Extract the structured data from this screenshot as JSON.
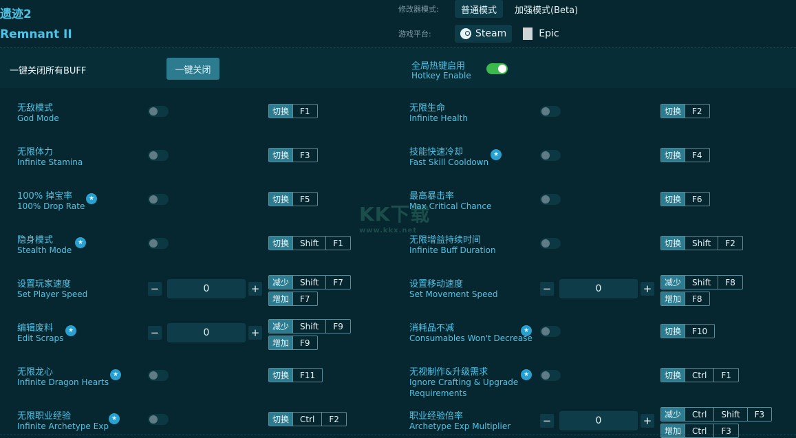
{
  "header": {
    "title_cn": "遗迹2",
    "title_en": "Remnant II",
    "mode_label": "修改器模式:",
    "mode_normal": "普通模式",
    "mode_beta": "加强模式(Beta)",
    "platform_label": "游戏平台:",
    "platform_steam": "Steam",
    "platform_epic": "Epic",
    "epic_logo_text": "EPIC GAMES"
  },
  "top": {
    "close_all_label": "一键关闭所有BUFF",
    "close_all_button": "一键关闭",
    "hotkey_cn": "全局热键启用",
    "hotkey_en": "Hotkey Enable",
    "hotkey_enabled": true
  },
  "actions": {
    "toggle": "切换",
    "decrease": "减少",
    "increase": "增加"
  },
  "watermark": {
    "big": "KK下载",
    "small": "www.kkx.net"
  },
  "left_cheats": [
    {
      "cn": "无敌模式",
      "en": "God Mode",
      "star": false,
      "type": "toggle",
      "keys": [
        "F1"
      ]
    },
    {
      "cn": "无限体力",
      "en": "Infinite Stamina",
      "star": false,
      "type": "toggle",
      "keys": [
        "F3"
      ]
    },
    {
      "cn": "100% 掉宝率",
      "en": "100% Drop Rate",
      "star": true,
      "type": "toggle",
      "keys": [
        "F5"
      ]
    },
    {
      "cn": "隐身模式",
      "en": "Stealth Mode",
      "star": true,
      "type": "toggle",
      "keys": [
        "Shift",
        "F1"
      ]
    },
    {
      "cn": "设置玩家速度",
      "en": "Set Player Speed",
      "star": false,
      "type": "number",
      "value": "0",
      "dec_keys": [
        "Shift",
        "F7"
      ],
      "inc_keys": [
        "F7"
      ]
    },
    {
      "cn": "编辑废料",
      "en": "Edit Scraps",
      "star": true,
      "type": "number",
      "value": "0",
      "dec_keys": [
        "Shift",
        "F9"
      ],
      "inc_keys": [
        "F9"
      ]
    },
    {
      "cn": "无限龙心",
      "en": "Infinite Dragon Hearts",
      "star": true,
      "type": "toggle",
      "keys": [
        "F11"
      ]
    },
    {
      "cn": "无限职业经验",
      "en": "Infinite Archetype Exp",
      "star": true,
      "type": "toggle",
      "keys": [
        "Ctrl",
        "F2"
      ]
    }
  ],
  "right_cheats": [
    {
      "cn": "无限生命",
      "en": "Infinite Health",
      "star": false,
      "type": "toggle",
      "keys": [
        "F2"
      ]
    },
    {
      "cn": "技能快速冷却",
      "en": "Fast Skill Cooldown",
      "star": true,
      "type": "toggle",
      "keys": [
        "F4"
      ]
    },
    {
      "cn": "最高暴击率",
      "en": "Max Critical Chance",
      "star": false,
      "type": "toggle",
      "keys": [
        "F6"
      ]
    },
    {
      "cn": "无限增益持续时间",
      "en": "Infinite Buff Duration",
      "star": false,
      "type": "toggle",
      "keys": [
        "Shift",
        "F2"
      ]
    },
    {
      "cn": "设置移动速度",
      "en": "Set Movement Speed",
      "star": false,
      "type": "number",
      "value": "0",
      "dec_keys": [
        "Shift",
        "F8"
      ],
      "inc_keys": [
        "F8"
      ]
    },
    {
      "cn": "消耗品不减",
      "en": "Consumables Won't Decrease",
      "star": true,
      "type": "toggle",
      "keys": [
        "F10"
      ]
    },
    {
      "cn": "无视制作&升级需求",
      "en": "Ignore Crafting & Upgrade Requirements",
      "star": true,
      "type": "toggle",
      "keys": [
        "Ctrl",
        "F1"
      ]
    },
    {
      "cn": "职业经验倍率",
      "en": "Archetype Exp Multiplier",
      "star": false,
      "type": "number",
      "value": "0",
      "dec_keys": [
        "Ctrl",
        "Shift",
        "F3"
      ],
      "inc_keys": [
        "Ctrl",
        "F3"
      ]
    }
  ]
}
